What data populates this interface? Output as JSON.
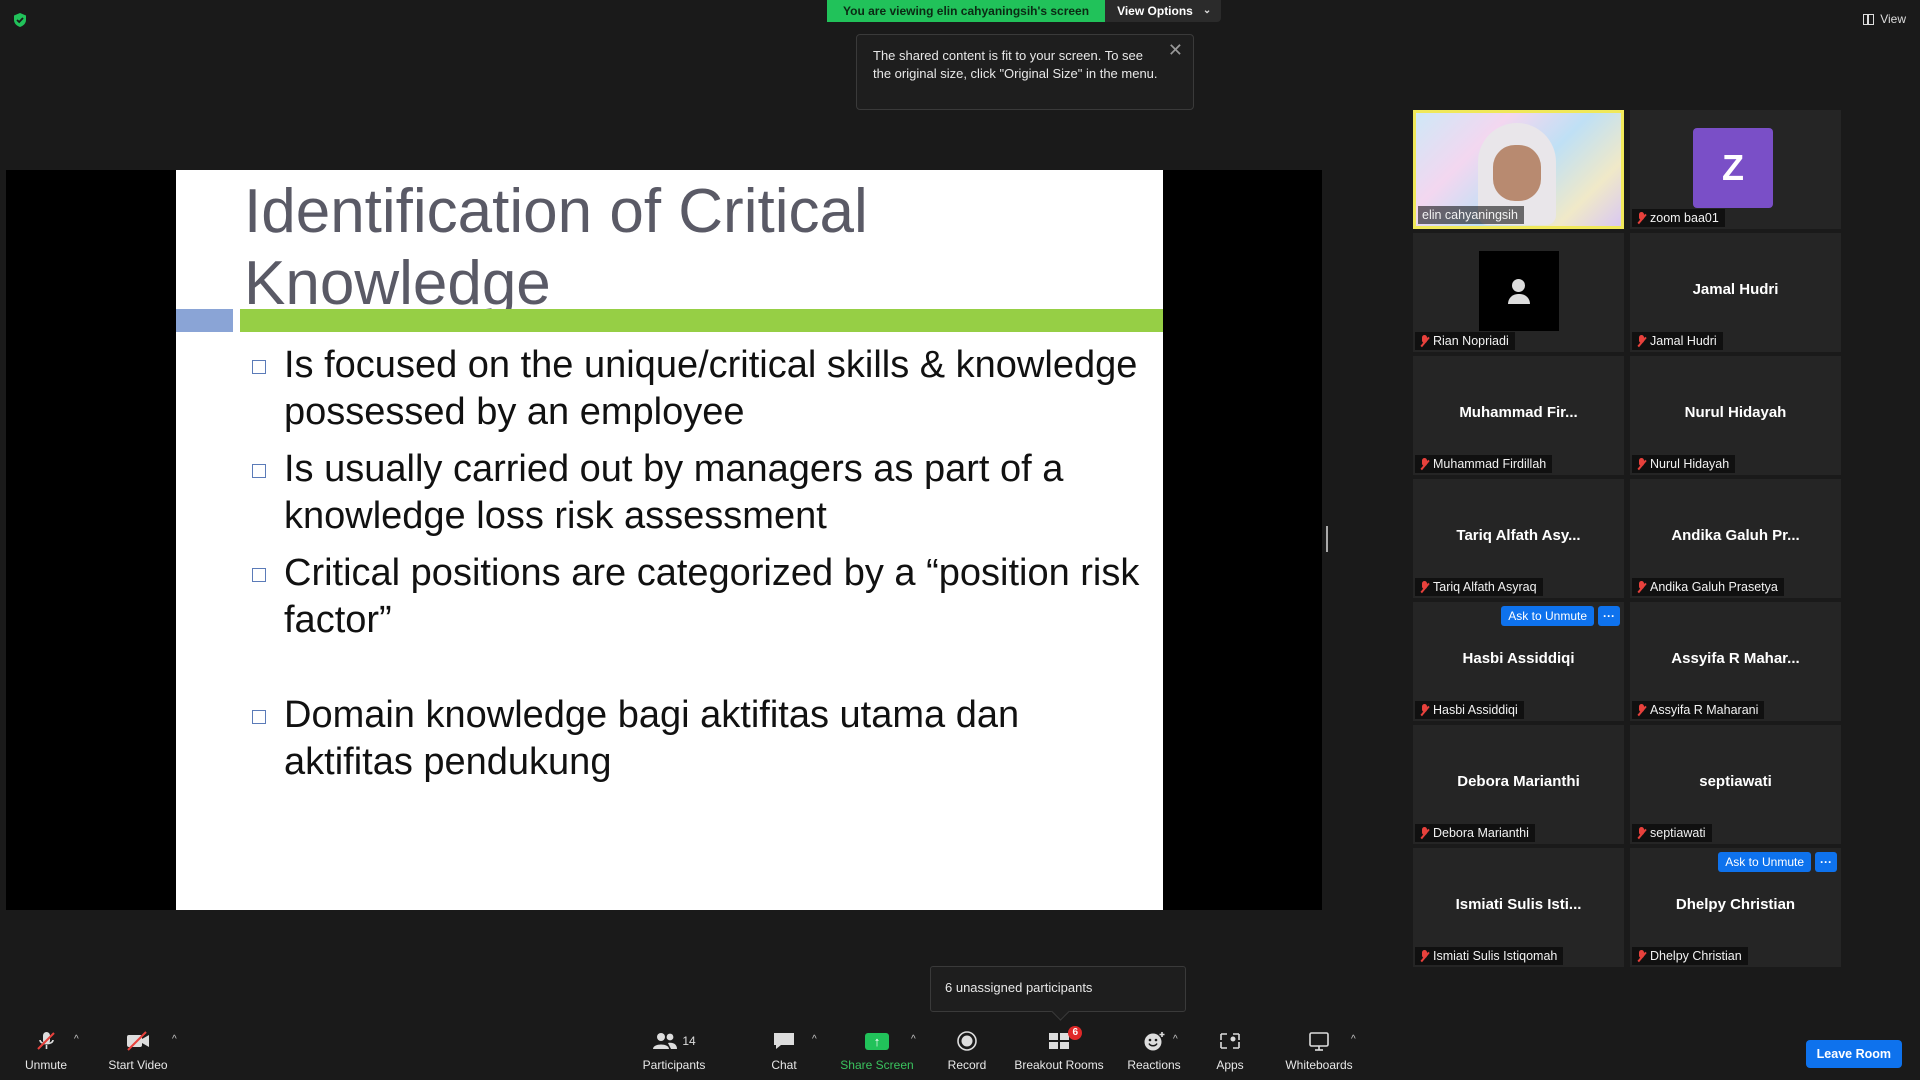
{
  "colors": {
    "banner_green": "#21c25a",
    "zoom_blue": "#0e72ed",
    "mute_red": "#e8413c",
    "slide_bar_blue": "#8aa4d6",
    "slide_bar_green": "#96cf45",
    "active_speaker": "#f0e85a"
  },
  "top": {
    "viewing_banner": "You are viewing elin cahyaningsih's screen",
    "view_options": "View Options",
    "view_label": "View"
  },
  "tooltip": {
    "text": "The shared content is fit to your screen. To see the original size, click \"Original Size\" in the menu."
  },
  "slide": {
    "title": "Identification of Critical Knowledge",
    "bullets": [
      "Is focused on the unique/critical skills & knowledge possessed by an employee",
      "Is usually carried out by managers as part of a knowledge loss risk assessment",
      "Critical positions are categorized by a “position risk factor”",
      "Domain knowledge bagi aktifitas utama dan aktifitas pendukung"
    ]
  },
  "participants": [
    {
      "name": "elin cahyaningsih",
      "big": "",
      "video": true,
      "active": true
    },
    {
      "name": "zoom baa01",
      "big": "",
      "avatar_letter": "Z"
    },
    {
      "name": "Rian Nopriadi",
      "big": "",
      "avatar_blank": true
    },
    {
      "name": "Jamal Hudri",
      "big": "Jamal Hudri"
    },
    {
      "name": "Muhammad Firdillah",
      "big": "Muhammad  Fir..."
    },
    {
      "name": "Nurul Hidayah",
      "big": "Nurul Hidayah"
    },
    {
      "name": "Tariq Alfath Asyraq",
      "big": "Tariq Alfath Asy..."
    },
    {
      "name": "Andika Galuh Prasetya",
      "big": "Andika  Galuh  Pr..."
    },
    {
      "name": "Hasbi Assiddiqi",
      "big": "Hasbi Assiddiqi",
      "ask_to_unmute": true
    },
    {
      "name": "Assyifa R Maharani",
      "big": "Assyifa  R  Mahar..."
    },
    {
      "name": "Debora Marianthi",
      "big": "Debora Marianthi"
    },
    {
      "name": "septiawati",
      "big": "septiawati"
    },
    {
      "name": "Ismiati Sulis Istiqomah",
      "big": "Ismiati  Sulis  Isti..."
    },
    {
      "name": "Dhelpy Christian",
      "big": "Dhelpy Christian",
      "ask_to_unmute": true
    }
  ],
  "ask_to_unmute_label": "Ask to Unmute",
  "more_label": "···",
  "toast": {
    "text": "6 unassigned participants"
  },
  "toolbar": {
    "unmute": "Unmute",
    "start_video": "Start Video",
    "participants": "Participants",
    "participants_count": "14",
    "chat": "Chat",
    "share_screen": "Share Screen",
    "record": "Record",
    "breakout_rooms": "Breakout Rooms",
    "breakout_badge": "6",
    "reactions": "Reactions",
    "apps": "Apps",
    "whiteboards": "Whiteboards",
    "leave_room": "Leave Room"
  }
}
